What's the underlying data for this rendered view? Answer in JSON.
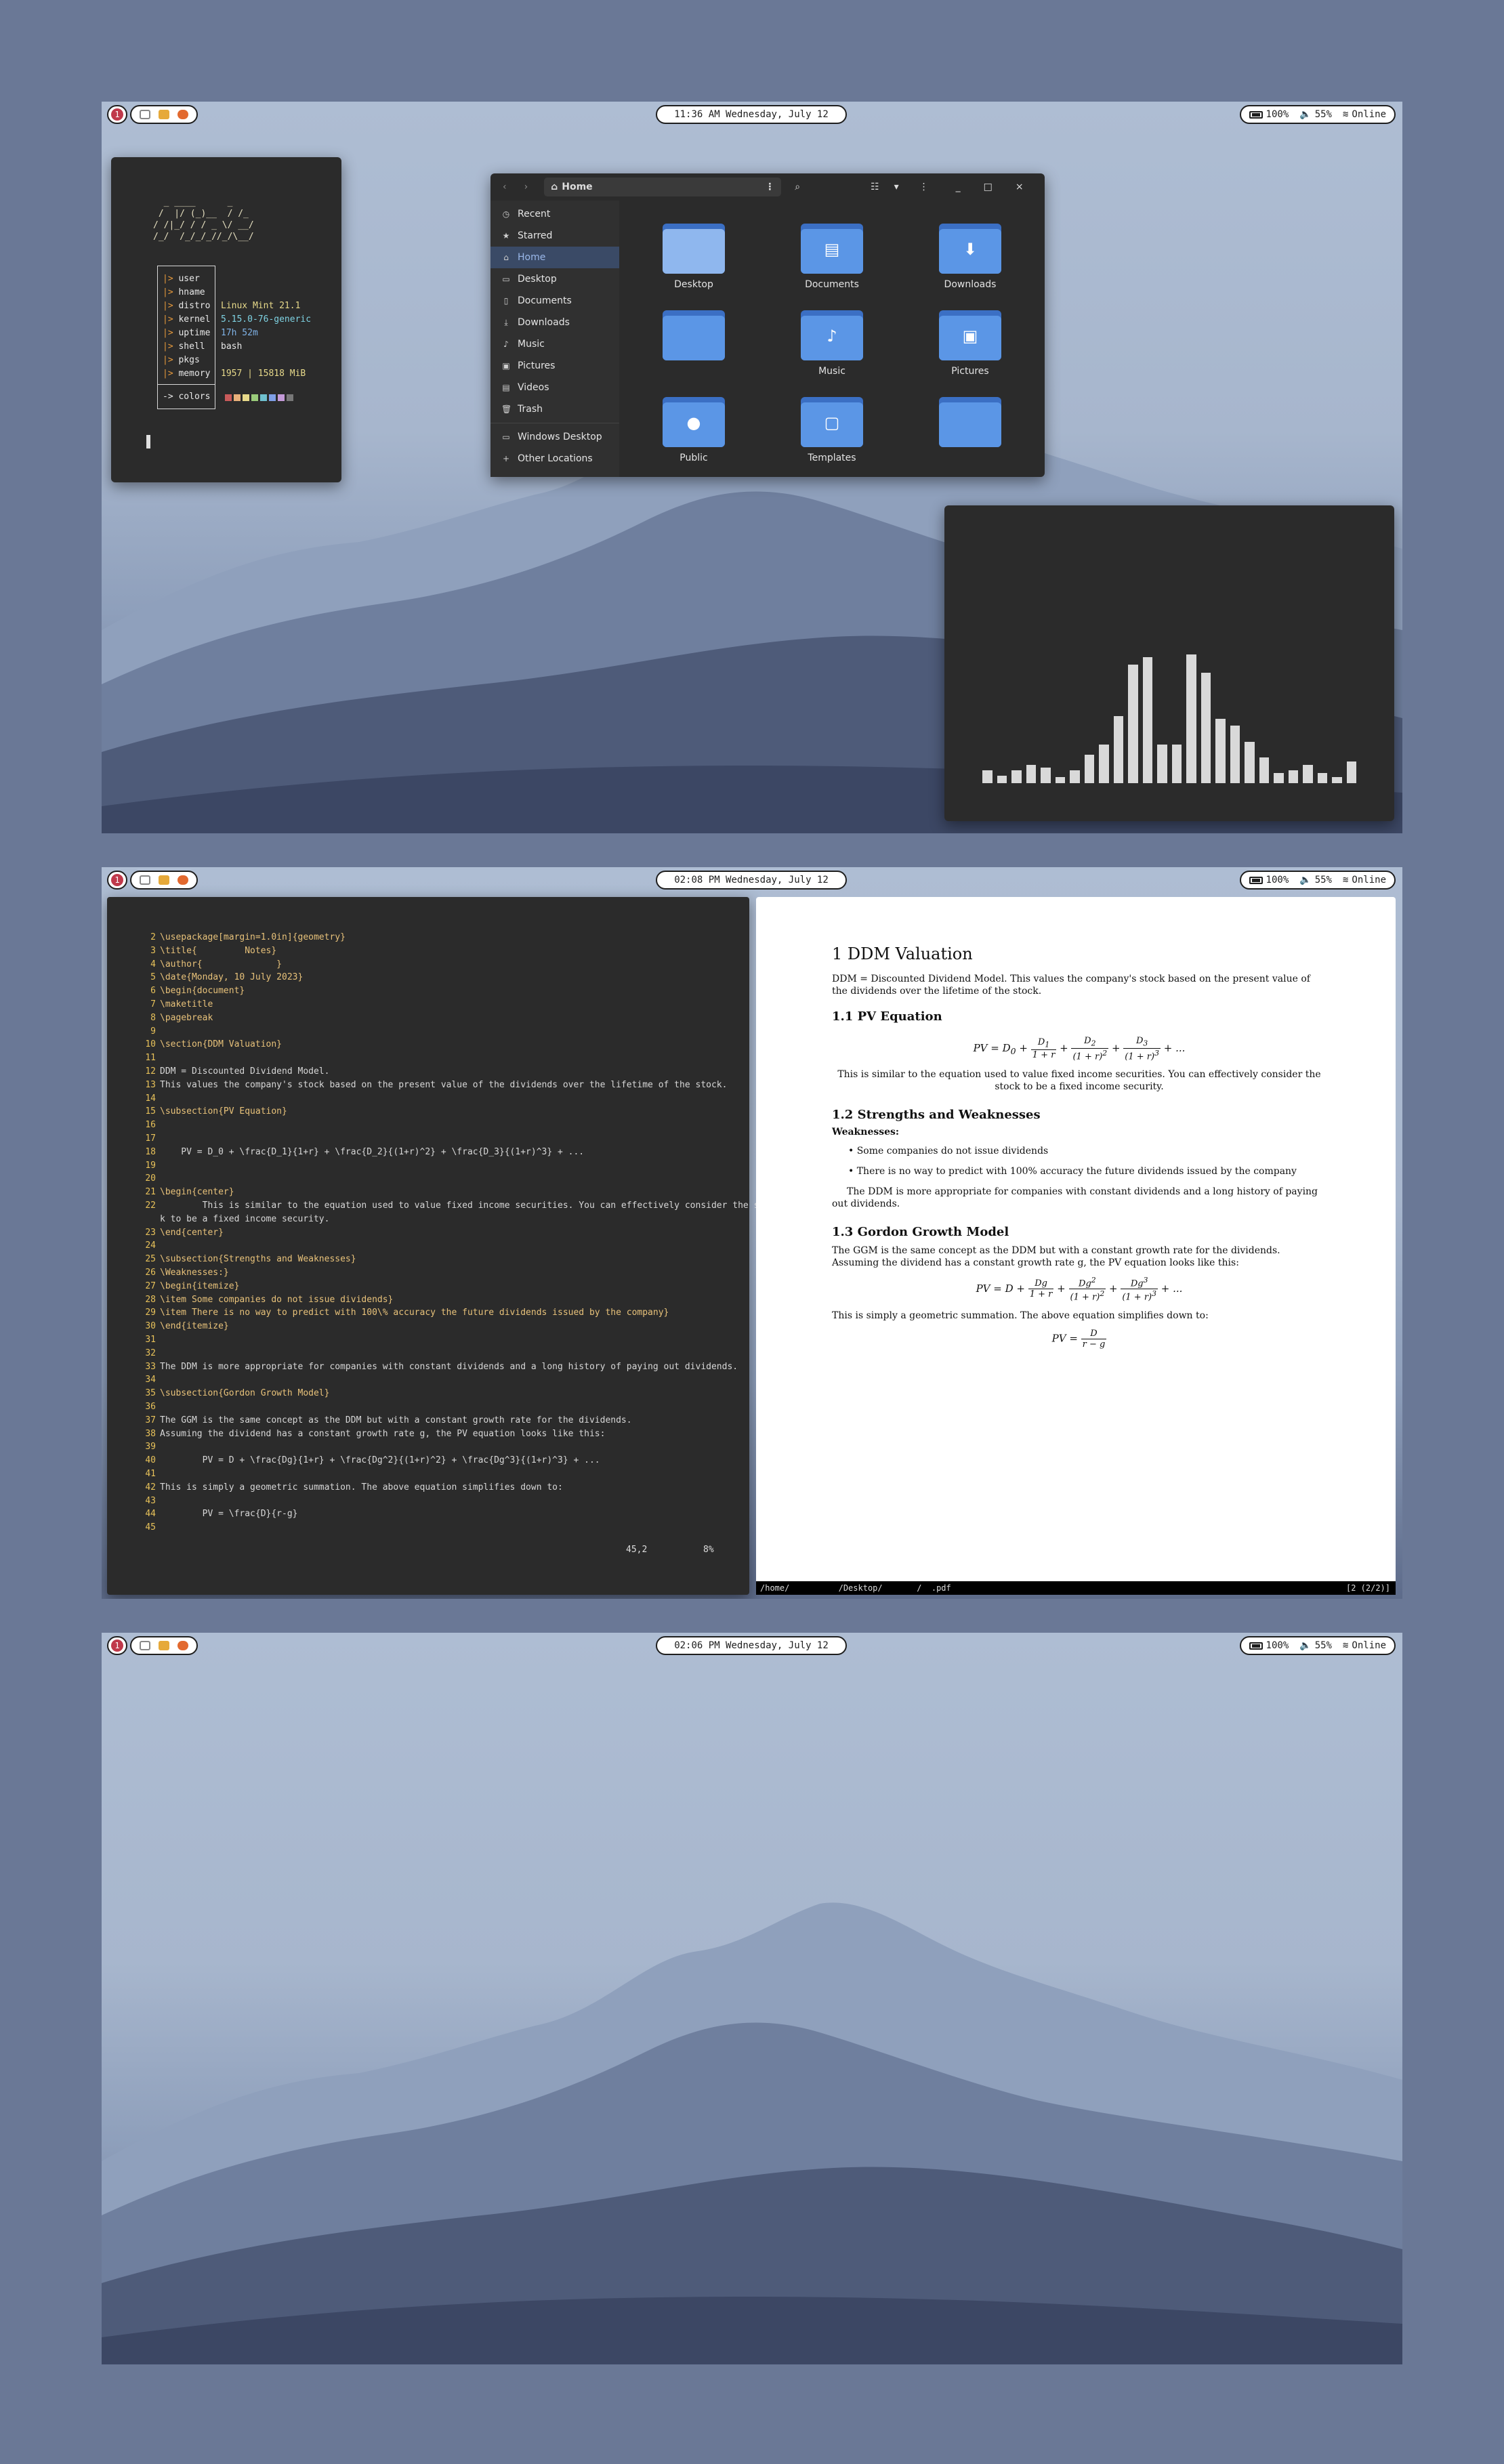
{
  "workspace": {
    "number": "1"
  },
  "desktop1": {
    "clock": "11:36 AM  Wednesday, July 12",
    "status": {
      "battery": "100%",
      "volume": "55%",
      "network": "Online"
    },
    "neofetch": {
      "ascii_logo": "  _ ____      _\n /  |/ (_)__  / /_\n/ /|_/ / / _ \\/ __/\n/_/  /_/_/_//_/\\__/",
      "keys": [
        "user",
        "hname",
        "distro",
        "kernel",
        "uptime",
        "shell",
        "pkgs",
        "memory"
      ],
      "distro": "Linux Mint 21.1",
      "kernel": "5.15.0-76-generic",
      "uptime": "17h 52m",
      "shell": "bash",
      "memory": "1957 | 15818 MiB",
      "colors_label": "colors"
    },
    "file_manager": {
      "location": "Home",
      "sidebar": [
        "Recent",
        "Starred",
        "Home",
        "Desktop",
        "Documents",
        "Downloads",
        "Music",
        "Pictures",
        "Videos",
        "Trash",
        "Windows Desktop",
        "Other Locations"
      ],
      "folders": [
        "Desktop",
        "Documents",
        "Downloads",
        "",
        "Music",
        "Pictures",
        "Public",
        "Templates",
        ""
      ]
    },
    "visualizer": {
      "levels": [
        0.1,
        0.06,
        0.1,
        0.14,
        0.12,
        0.05,
        0.1,
        0.22,
        0.3,
        0.52,
        0.92,
        0.98,
        0.3,
        0.3,
        1.0,
        0.86,
        0.5,
        0.45,
        0.32,
        0.2,
        0.08,
        0.1,
        0.14,
        0.08,
        0.05,
        0.17
      ]
    }
  },
  "desktop2": {
    "clock": "02:08 PM  Wednesday, July 12",
    "status": {
      "battery": "100%",
      "volume": "55%",
      "network": "Online"
    },
    "editor": {
      "lines": [
        [
          "2",
          "\\usepackage[margin=1.0in]{geometry}"
        ],
        [
          "3",
          "\\title{         Notes}"
        ],
        [
          "4",
          "\\author{              }"
        ],
        [
          "5",
          "\\date{Monday, 10 July 2023}"
        ],
        [
          "6",
          "\\begin{document}"
        ],
        [
          "7",
          "\\maketitle"
        ],
        [
          "8",
          "\\pagebreak"
        ],
        [
          "9",
          ""
        ],
        [
          "10",
          "\\section{DDM Valuation}"
        ],
        [
          "11",
          ""
        ],
        [
          "12",
          "DDM = Discounted Dividend Model."
        ],
        [
          "13",
          "This values the company's stock based on the present value of the dividends over the lifetime of the stock."
        ],
        [
          "14",
          ""
        ],
        [
          "15",
          "\\subsection{PV Equation}"
        ],
        [
          "16",
          ""
        ],
        [
          "17",
          ""
        ],
        [
          "18",
          "    PV = D_0 + \\frac{D_1}{1+r} + \\frac{D_2}{(1+r)^2} + \\frac{D_3}{(1+r)^3} + ..."
        ],
        [
          "19",
          ""
        ],
        [
          "20",
          ""
        ],
        [
          "21",
          "\\begin{center}"
        ],
        [
          "22",
          "        This is similar to the equation used to value fixed income securities. You can effectively consider the stoc"
        ],
        [
          "",
          "k to be a fixed income security."
        ],
        [
          "23",
          "\\end{center}"
        ],
        [
          "24",
          ""
        ],
        [
          "25",
          "\\subsection{Strengths and Weaknesses}"
        ],
        [
          "26",
          "\\Weaknesses:}"
        ],
        [
          "27",
          "\\begin{itemize}"
        ],
        [
          "28",
          "\\item Some companies do not issue dividends}"
        ],
        [
          "29",
          "\\item There is no way to predict with 100\\% accuracy the future dividends issued by the company}"
        ],
        [
          "30",
          "\\end{itemize}"
        ],
        [
          "31",
          ""
        ],
        [
          "32",
          ""
        ],
        [
          "33",
          "The DDM is more appropriate for companies with constant dividends and a long history of paying out dividends."
        ],
        [
          "34",
          ""
        ],
        [
          "35",
          "\\subsection{Gordon Growth Model}"
        ],
        [
          "36",
          ""
        ],
        [
          "37",
          "The GGM is the same concept as the DDM but with a constant growth rate for the dividends."
        ],
        [
          "38",
          "Assuming the dividend has a constant growth rate g, the PV equation looks like this:"
        ],
        [
          "39",
          ""
        ],
        [
          "40",
          "        PV = D + \\frac{Dg}{1+r} + \\frac{Dg^2}{(1+r)^2} + \\frac{Dg^3}{(1+r)^3} + ..."
        ],
        [
          "41",
          ""
        ],
        [
          "42",
          "This is simply a geometric summation. The above equation simplifies down to:"
        ],
        [
          "43",
          ""
        ],
        [
          "44",
          "        PV = \\frac{D}{r-g}"
        ],
        [
          "45",
          ""
        ]
      ],
      "cursor_pos": "45,2",
      "scroll_pct": "8%"
    },
    "pdf": {
      "section": "1   DDM Valuation",
      "s1_text": "DDM = Discounted Dividend Model.  This values the company's stock based on the present value of the dividends over the lifetime of the stock.",
      "sub1": "1.1   PV Equation",
      "sub1_text": "This is similar to the equation used to value fixed income securities. You can effectively consider the stock to be a fixed income security.",
      "sub2": "1.2   Strengths and Weaknesses",
      "weak_label": "Weaknesses:",
      "bullet1": "Some companies do not issue dividends",
      "bullet2": "There is no way to predict with 100% accuracy the future dividends issued by the company",
      "sub2_text": "The DDM is more appropriate for companies with constant dividends and a long history of paying out dividends.",
      "sub3": "1.3   Gordon Growth Model",
      "sub3_text": "The GGM is the same concept as the DDM but with a constant growth rate for the dividends.  Assuming the dividend has a constant growth rate g, the PV equation looks like this:",
      "sub3_text2": "This is simply a geometric summation.  The above equation simplifies down to:",
      "status_left": "/home/          /Desktop/       /  .pdf",
      "status_right": "[2 (2/2)]"
    }
  },
  "desktop3": {
    "clock": "02:06 PM  Wednesday, July 12",
    "status": {
      "battery": "100%",
      "volume": "55%",
      "network": "Online"
    }
  }
}
